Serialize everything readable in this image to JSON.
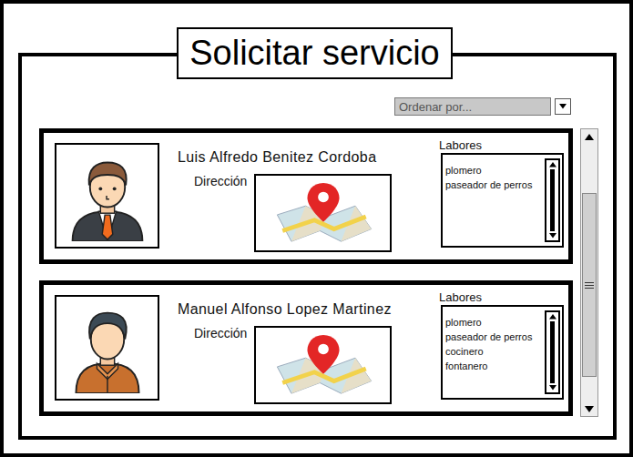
{
  "window": {
    "title": "Solicitar servicio"
  },
  "sort": {
    "placeholder": "Ordenar por..."
  },
  "providers": [
    {
      "name": "Luis Alfredo Benitez Cordoba",
      "kind": "suit",
      "address_label": "Dirección",
      "tasks_label": "Labores",
      "tasks": [
        "plomero",
        "paseador de perros"
      ]
    },
    {
      "name": "Manuel Alfonso Lopez Martinez",
      "kind": "casual",
      "address_label": "Dirección",
      "tasks_label": "Labores",
      "tasks": [
        "plomero",
        "paseador de perros",
        "cocinero",
        "fontanero"
      ]
    }
  ]
}
